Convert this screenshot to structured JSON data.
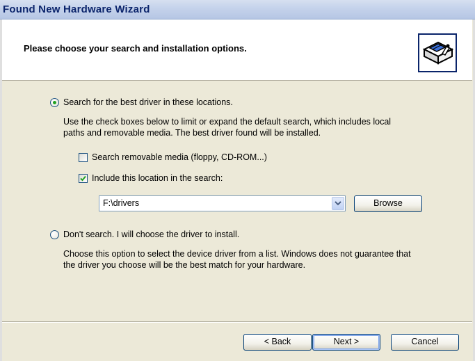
{
  "window": {
    "title": "Found New Hardware Wizard"
  },
  "header": {
    "title": "Please choose your search and installation options.",
    "icon": "hardware-wizard-icon"
  },
  "options": {
    "search": {
      "label": "Search for the best driver in these locations.",
      "selected": true,
      "description_line1": "Use the check boxes below to limit or expand the default search, which includes local",
      "description_line2": "paths and removable media. The best driver found will be installed.",
      "removable_media": {
        "label": "Search removable media (floppy, CD-ROM...)",
        "checked": false
      },
      "include_location": {
        "label": "Include this location in the search:",
        "checked": true
      },
      "location_value": "F:\\drivers",
      "browse_label": "Browse"
    },
    "dont_search": {
      "label": "Don't search. I will choose the driver to install.",
      "selected": false,
      "description_line1": "Choose this option to select the device driver from a list.  Windows does not guarantee that",
      "description_line2": "the driver you choose will be the best match for your hardware."
    }
  },
  "footer": {
    "back_label": "< Back",
    "next_label": "Next >",
    "cancel_label": "Cancel"
  }
}
